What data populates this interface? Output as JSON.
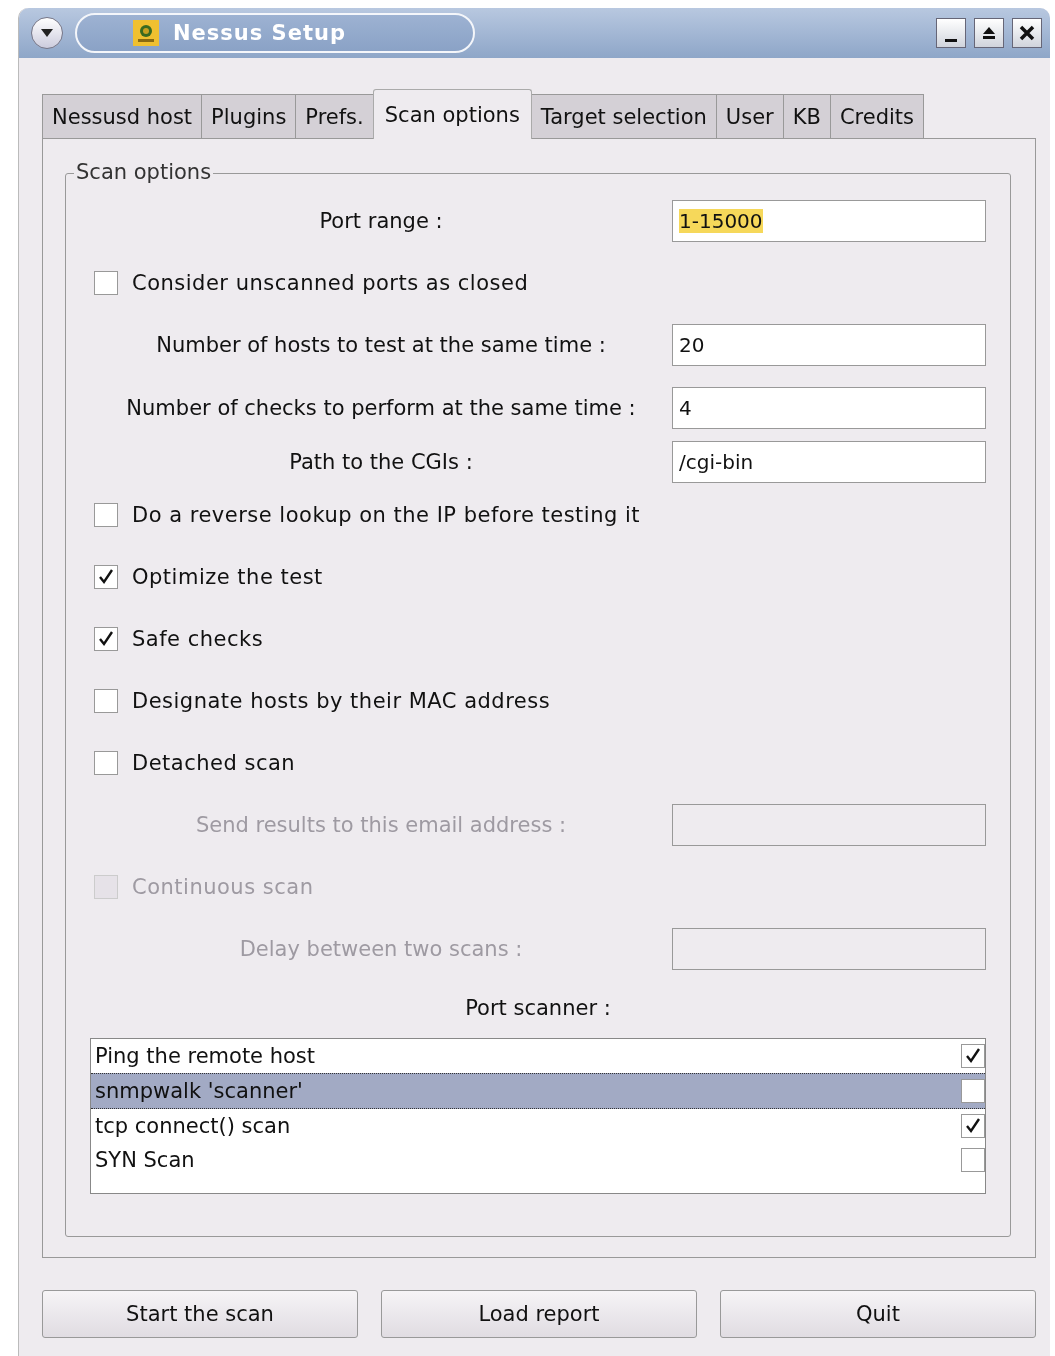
{
  "window": {
    "title": "Nessus Setup"
  },
  "tabs": [
    {
      "label": "Nessusd host",
      "selected": false
    },
    {
      "label": "Plugins",
      "selected": false
    },
    {
      "label": "Prefs.",
      "selected": false
    },
    {
      "label": "Scan options",
      "selected": true
    },
    {
      "label": "Target selection",
      "selected": false
    },
    {
      "label": "User",
      "selected": false
    },
    {
      "label": "KB",
      "selected": false
    },
    {
      "label": "Credits",
      "selected": false
    }
  ],
  "group": {
    "title": "Scan options"
  },
  "options": [
    {
      "kind": "field",
      "label": "Port range :",
      "value": "1-15000",
      "highlighted": true,
      "disabled": false
    },
    {
      "kind": "check",
      "label": "Consider unscanned ports as closed",
      "checked": false,
      "disabled": false
    },
    {
      "kind": "field",
      "label": "Number of hosts to test at the same time :",
      "value": "20",
      "disabled": false
    },
    {
      "kind": "field",
      "label": "Number of checks to perform at the same time :",
      "value": "4",
      "disabled": false
    },
    {
      "kind": "field",
      "label": "Path to the CGIs :",
      "value": "/cgi-bin",
      "disabled": false
    },
    {
      "kind": "check",
      "label": "Do a reverse lookup on the IP before testing it",
      "checked": false,
      "disabled": false
    },
    {
      "kind": "check",
      "label": "Optimize the test",
      "checked": true,
      "disabled": false
    },
    {
      "kind": "check",
      "label": "Safe checks",
      "checked": true,
      "disabled": false
    },
    {
      "kind": "check",
      "label": "Designate hosts by their MAC address",
      "checked": false,
      "disabled": false
    },
    {
      "kind": "check",
      "label": "Detached scan",
      "checked": false,
      "disabled": false
    },
    {
      "kind": "field",
      "label": "Send results to this email address :",
      "disabled": true
    },
    {
      "kind": "check",
      "label": "Continuous scan",
      "checked": false,
      "disabled": true
    },
    {
      "kind": "field",
      "label": "Delay between two scans :",
      "disabled": true
    }
  ],
  "port_scanner": {
    "label": "Port scanner :",
    "items": [
      {
        "label": "Ping the remote host",
        "checked": true,
        "selected": false
      },
      {
        "label": "snmpwalk 'scanner'",
        "checked": false,
        "selected": true
      },
      {
        "label": "tcp connect() scan",
        "checked": true,
        "selected": false
      },
      {
        "label": "SYN Scan",
        "checked": false,
        "selected": false
      }
    ]
  },
  "buttons": [
    "Start the scan",
    "Load report",
    "Quit"
  ]
}
